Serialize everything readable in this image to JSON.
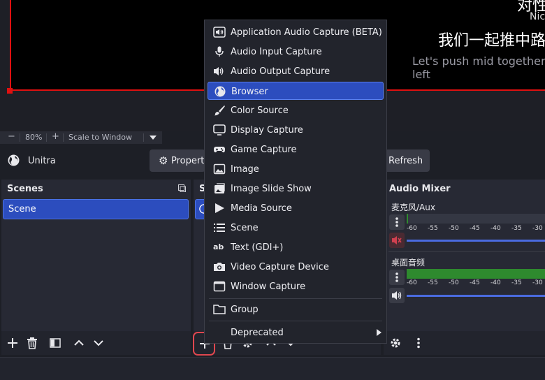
{
  "preview": {
    "chinese_title_partial": "对性",
    "line_name_partial": "Nic",
    "chinese_line": "我们一起推中路",
    "english_line_1": "Let's push mid together a",
    "english_line_2": "left"
  },
  "zoom_bar": {
    "minus": "−",
    "zoom": "80%",
    "plus": "+",
    "scale_mode": "Scale to Window"
  },
  "context_bar": {
    "source_name": "Unitra",
    "properties_label": "Properti",
    "refresh_label": "Refresh"
  },
  "scenes": {
    "title": "Scenes",
    "items": [
      "Scene"
    ]
  },
  "sources": {
    "title_partial": "S"
  },
  "mixer": {
    "title": "Audio Mixer",
    "channels": [
      {
        "name": "麦克风/Aux",
        "muted": true,
        "level": 0.0
      },
      {
        "name": "桌面音频",
        "muted": false,
        "level": 0.0
      }
    ],
    "scale": [
      "-60",
      "-55",
      "-50",
      "-45",
      "-40",
      "-35",
      "-30"
    ]
  },
  "add_source_menu": {
    "items": [
      {
        "label": "Application Audio Capture (BETA)",
        "icon": "app-audio-icon"
      },
      {
        "label": "Audio Input Capture",
        "icon": "microphone-icon"
      },
      {
        "label": "Audio Output Capture",
        "icon": "speaker-icon"
      },
      {
        "label": "Browser",
        "icon": "globe-icon",
        "active": true
      },
      {
        "label": "Color Source",
        "icon": "brush-icon"
      },
      {
        "label": "Display Capture",
        "icon": "monitor-icon"
      },
      {
        "label": "Game Capture",
        "icon": "gamepad-icon"
      },
      {
        "label": "Image",
        "icon": "image-icon"
      },
      {
        "label": "Image Slide Show",
        "icon": "slideshow-icon"
      },
      {
        "label": "Media Source",
        "icon": "play-icon"
      },
      {
        "label": "Scene",
        "icon": "list-icon"
      },
      {
        "label": "Text (GDI+)",
        "icon": "text-icon"
      },
      {
        "label": "Video Capture Device",
        "icon": "camera-icon"
      },
      {
        "label": "Window Capture",
        "icon": "window-icon"
      }
    ],
    "group_label": "Group",
    "deprecated_label": "Deprecated"
  },
  "colors": {
    "accent": "#2c4dbe",
    "highlight_ring": "#e0474f",
    "canvas_border": "#e01010"
  }
}
